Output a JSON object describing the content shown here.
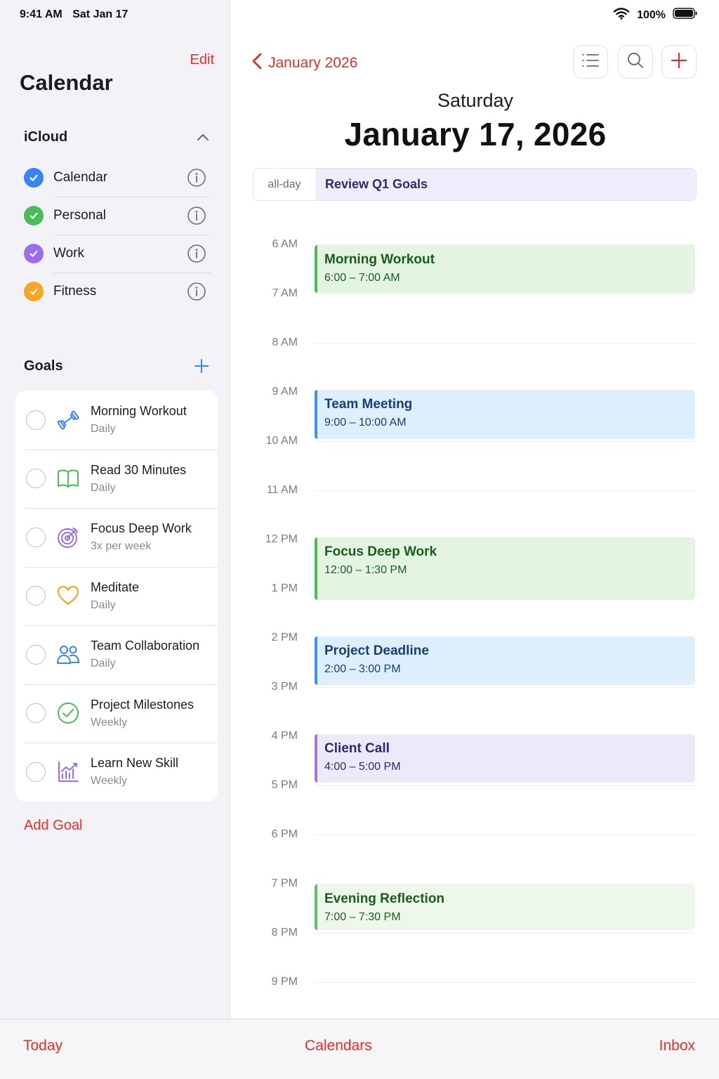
{
  "status_bar": {
    "time": "9:41 AM",
    "date": "Sat Jan 17",
    "battery": "100%"
  },
  "sidebar": {
    "edit_label": "Edit",
    "title": "Calendar",
    "icloud_label": "iCloud",
    "calendars": [
      {
        "label": "Calendar",
        "color": "#3b82f6"
      },
      {
        "label": "Personal",
        "color": "#4cbb5a"
      },
      {
        "label": "Work",
        "color": "#9b6cf0"
      },
      {
        "label": "Fitness",
        "color": "#f5a623"
      }
    ],
    "goals_label": "Goals",
    "goals": [
      {
        "title": "Morning Workout",
        "frequency": "Daily",
        "icon": "dumbbell-icon"
      },
      {
        "title": "Read 30 Minutes",
        "frequency": "Daily",
        "icon": "book-icon"
      },
      {
        "title": "Focus Deep Work",
        "frequency": "3x per week",
        "icon": "target-icon"
      },
      {
        "title": "Meditate",
        "frequency": "Daily",
        "icon": "heart-icon"
      },
      {
        "title": "Team Collaboration",
        "frequency": "Daily",
        "icon": "people-icon"
      },
      {
        "title": "Project Milestones",
        "frequency": "Weekly",
        "icon": "check-circle-icon"
      },
      {
        "title": "Learn New Skill",
        "frequency": "Weekly",
        "icon": "chart-icon"
      }
    ],
    "add_goal_label": "Add Goal"
  },
  "header": {
    "back_label": "January 2026",
    "day_name": "Saturday",
    "full_date": "January 17, 2026"
  },
  "all_day": {
    "label": "all-day",
    "event": "Review Q1 Goals"
  },
  "hours": [
    "6 AM",
    "7 AM",
    "8 AM",
    "9 AM",
    "10 AM",
    "11 AM",
    "12 PM",
    "1 PM",
    "2 PM",
    "3 PM",
    "4 PM",
    "5 PM",
    "6 PM",
    "7 PM",
    "8 PM",
    "9 PM"
  ],
  "events": [
    {
      "title": "Morning Workout",
      "time": "6:00 – 7:00 AM",
      "style": "green"
    },
    {
      "title": "Team Meeting",
      "time": "9:00 – 10:00 AM",
      "style": "blue"
    },
    {
      "title": "Focus Deep Work",
      "time": "12:00 – 1:30 PM",
      "style": "green"
    },
    {
      "title": "Project Deadline",
      "time": "2:00 – 3:00 PM",
      "style": "blue"
    },
    {
      "title": "Client Call",
      "time": "4:00 – 5:00 PM",
      "style": "purple"
    },
    {
      "title": "Evening Reflection",
      "time": "7:00 – 7:30 PM",
      "style": "lightgreen"
    }
  ],
  "tabs": {
    "today": "Today",
    "calendars": "Calendars",
    "inbox": "Inbox"
  },
  "colors": {
    "accent": "#e0302a"
  }
}
